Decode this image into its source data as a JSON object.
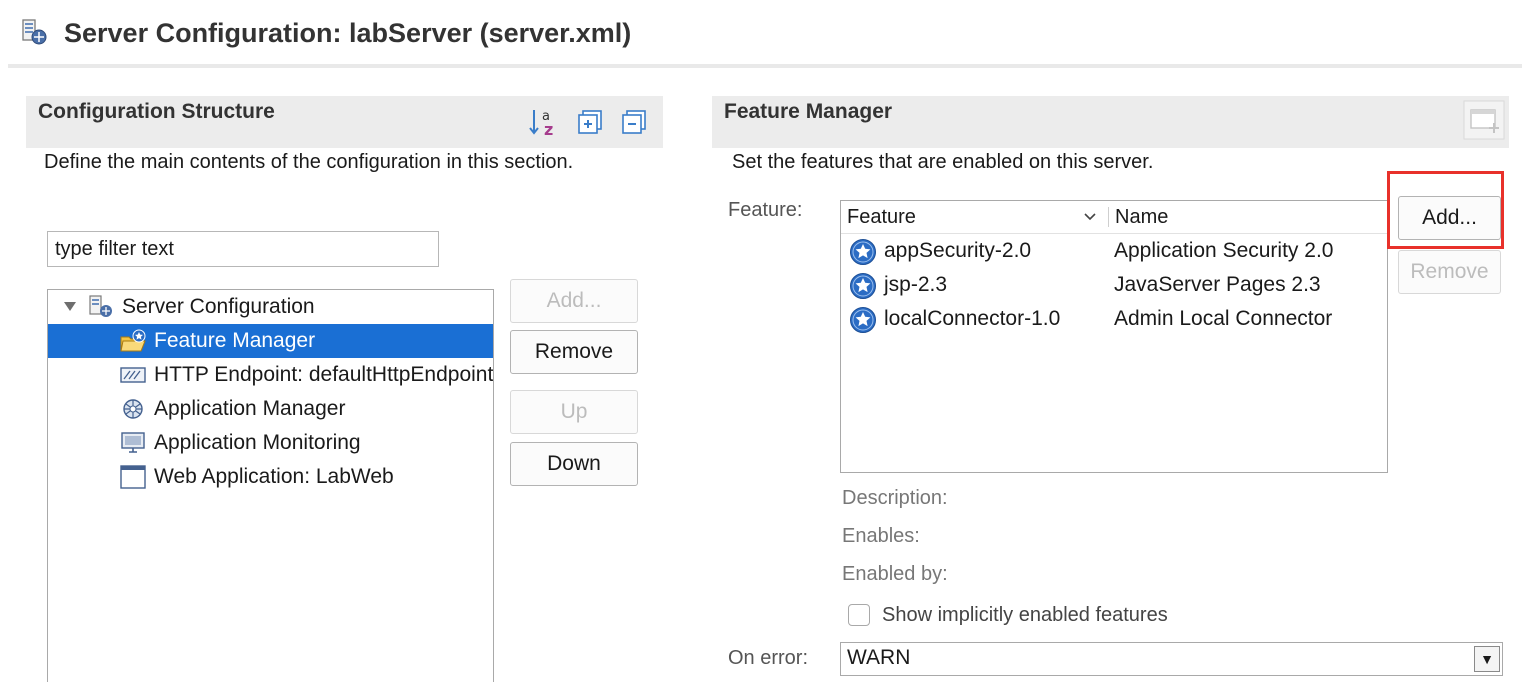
{
  "header": {
    "title": "Server Configuration: labServer (server.xml)",
    "icon": "server-config-icon"
  },
  "left_section": {
    "title": "Configuration Structure",
    "description": "Define the main contents of the configuration in this section.",
    "toolbar_icons": [
      "sort-az-icon",
      "expand-all-icon",
      "collapse-all-icon"
    ],
    "filter": {
      "placeholder": "type filter text",
      "value": "type filter text"
    },
    "tree": [
      {
        "label": "Server Configuration",
        "icon": "server-config-icon",
        "expanded": true
      },
      {
        "label": "Feature Manager",
        "icon": "feature-manager-icon",
        "selected": true
      },
      {
        "label": "HTTP Endpoint: defaultHttpEndpoint",
        "icon": "http-endpoint-icon"
      },
      {
        "label": "Application Manager",
        "icon": "application-manager-icon"
      },
      {
        "label": "Application Monitoring",
        "icon": "monitor-icon"
      },
      {
        "label": "Web Application: LabWeb",
        "icon": "web-application-icon"
      }
    ],
    "buttons": {
      "add": "Add...",
      "remove": "Remove",
      "up": "Up",
      "down": "Down"
    }
  },
  "right_section": {
    "title": "Feature Manager",
    "description": "Set the features that are enabled on this server.",
    "feature_label": "Feature:",
    "table": {
      "columns": [
        "Feature",
        "Name"
      ],
      "rows": [
        {
          "feature": "appSecurity-2.0",
          "name": "Application Security 2.0"
        },
        {
          "feature": "jsp-2.3",
          "name": "JavaServer Pages 2.3"
        },
        {
          "feature": "localConnector-1.0",
          "name": "Admin Local Connector"
        }
      ]
    },
    "buttons": {
      "add": "Add...",
      "remove": "Remove"
    },
    "description_label": "Description:",
    "enables_label": "Enables:",
    "enabled_by_label": "Enabled by:",
    "show_implicit_label": "Show implicitly enabled features",
    "on_error_label": "On error:",
    "on_error_value": "WARN"
  },
  "colors": {
    "selection": "#1a6fd4",
    "highlight_box": "#e8312a",
    "section_header_bg": "#ececec"
  }
}
